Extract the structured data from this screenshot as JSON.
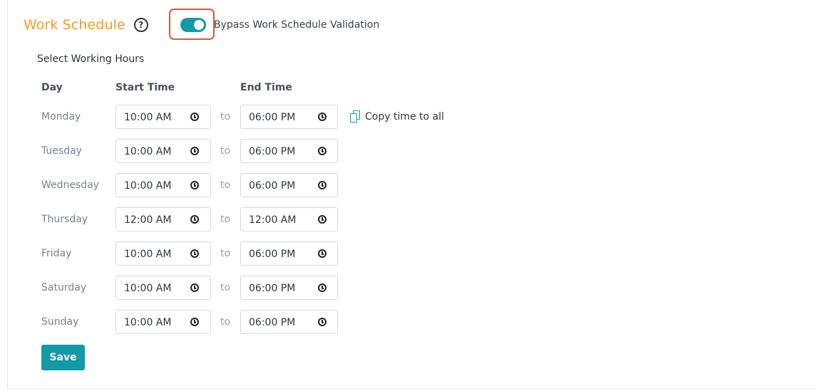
{
  "header": {
    "title": "Work Schedule",
    "help_glyph": "?",
    "help_icon": "question-circle-icon",
    "bypass_toggle": {
      "on": true,
      "label": "Bypass Work Schedule Validation"
    }
  },
  "schedule": {
    "section_label": "Select Working Hours",
    "columns": {
      "day": "Day",
      "start": "Start Time",
      "end": "End Time"
    },
    "separator": "to",
    "copy_label": "Copy time to all",
    "copy_icon": "copy-icon",
    "clock_icon": "clock-icon",
    "rows": [
      {
        "day": "Monday",
        "start": "10:00 AM",
        "end": "06:00 PM"
      },
      {
        "day": "Tuesday",
        "start": "10:00 AM",
        "end": "06:00 PM"
      },
      {
        "day": "Wednesday",
        "start": "10:00 AM",
        "end": "06:00 PM"
      },
      {
        "day": "Thursday",
        "start": "12:00 AM",
        "end": "12:00 AM"
      },
      {
        "day": "Friday",
        "start": "10:00 AM",
        "end": "06:00 PM"
      },
      {
        "day": "Saturday",
        "start": "10:00 AM",
        "end": "06:00 PM"
      },
      {
        "day": "Sunday",
        "start": "10:00 AM",
        "end": "06:00 PM"
      }
    ]
  },
  "actions": {
    "save_label": "Save"
  },
  "colors": {
    "accent": "#139aa6",
    "title": "#f59a23",
    "highlight": "#d9573f"
  }
}
